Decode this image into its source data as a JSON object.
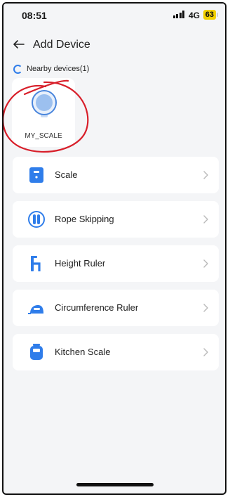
{
  "status_bar": {
    "time": "08:51",
    "network": "4G",
    "battery": "63"
  },
  "header": {
    "title": "Add Device",
    "back_icon": "back-arrow-icon"
  },
  "nearby": {
    "label": "Nearby devices(1)",
    "status_icon": "loading-spinner-icon"
  },
  "nearby_devices": [
    {
      "name": "MY_SCALE",
      "icon": "scale-device-icon"
    }
  ],
  "categories": [
    {
      "label": "Scale",
      "icon": "scale-icon"
    },
    {
      "label": "Rope Skipping",
      "icon": "rope-skipping-icon"
    },
    {
      "label": "Height Ruler",
      "icon": "height-ruler-icon"
    },
    {
      "label": "Circumference Ruler",
      "icon": "circumference-ruler-icon"
    },
    {
      "label": "Kitchen Scale",
      "icon": "kitchen-scale-icon"
    }
  ],
  "colors": {
    "accent": "#2f7dea",
    "annotation": "#d81f2a",
    "background": "#f4f5f7",
    "battery": "#f2d000"
  }
}
